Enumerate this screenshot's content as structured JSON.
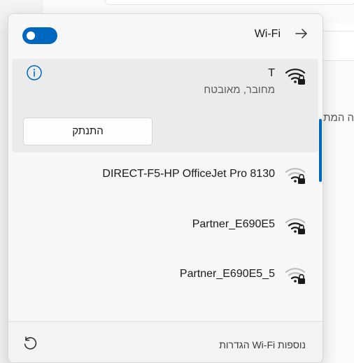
{
  "background": {
    "partial_text": "ה המתנ"
  },
  "flyout": {
    "title": "Wi-Fi",
    "toggle_state": "on",
    "accent_color": "#0067c0"
  },
  "networks": [
    {
      "name": "T",
      "status": "מחובר, מאובטח",
      "signal": "full",
      "secured": true,
      "connected": true,
      "action_label": "התנתק"
    },
    {
      "name": "DIRECT-F5-HP OfficeJet Pro 8130",
      "signal": "low",
      "secured": true
    },
    {
      "name": "Partner_E690E5",
      "signal": "medium",
      "secured": true
    },
    {
      "name": "Partner_E690E5_5",
      "signal": "low",
      "secured": true
    }
  ],
  "footer": {
    "more_settings_label": "הגדרות Wi-Fi נוספות",
    "refresh_icon": "refresh-icon"
  }
}
